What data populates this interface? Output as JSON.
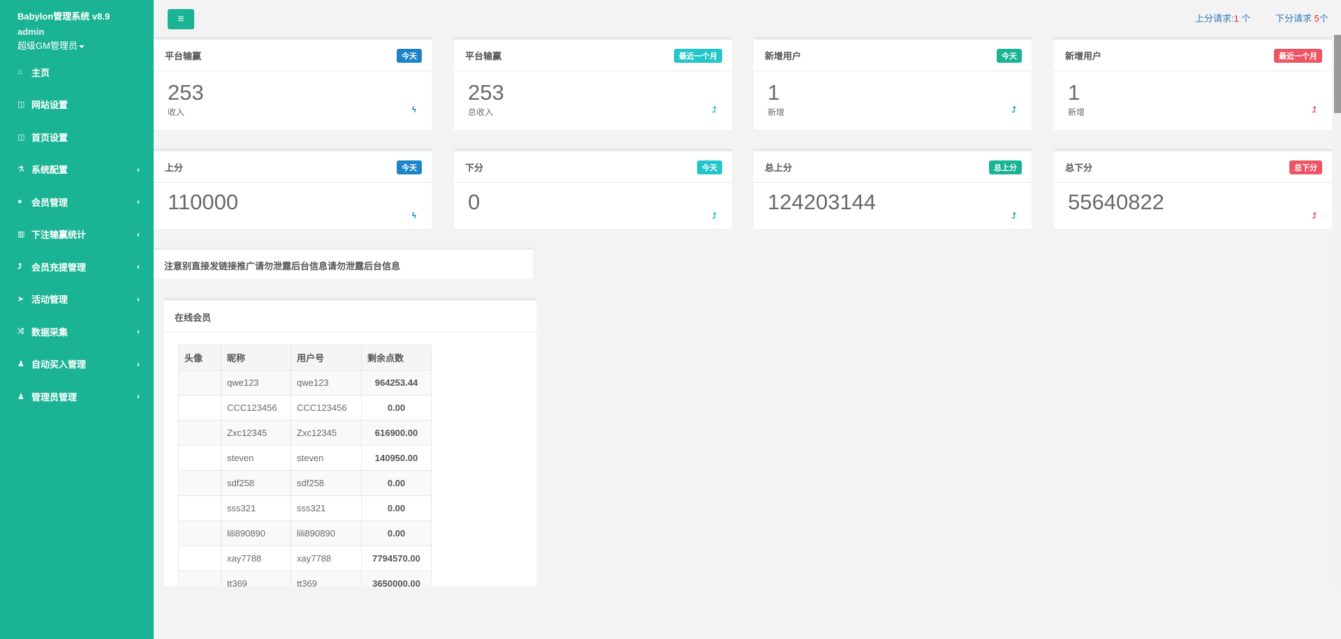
{
  "sidebar": {
    "brand": "Babylon管理系统 v8.9",
    "user": "admin",
    "role": "超级GM管理员",
    "items": [
      {
        "label": "主页",
        "icon": "home-icon",
        "glyph": "⌂",
        "sub": false
      },
      {
        "label": "网站设置",
        "icon": "columns-icon",
        "glyph": "◫",
        "sub": false
      },
      {
        "label": "首页设置",
        "icon": "columns-icon",
        "glyph": "◫",
        "sub": false
      },
      {
        "label": "系统配置",
        "icon": "flask-icon",
        "glyph": "⚗",
        "sub": true
      },
      {
        "label": "会员管理",
        "icon": "user-icon",
        "glyph": "●",
        "sub": true
      },
      {
        "label": "下注输赢统计",
        "icon": "bar-chart-icon",
        "glyph": "▥",
        "sub": true
      },
      {
        "label": "会员充提管理",
        "icon": "level-up-icon",
        "glyph": "⮥",
        "sub": true
      },
      {
        "label": "活动管理",
        "icon": "paper-plane-icon",
        "glyph": "➤",
        "sub": true
      },
      {
        "label": "数据采集",
        "icon": "random-icon",
        "glyph": "⤨",
        "sub": true
      },
      {
        "label": "自动买入管理",
        "icon": "male-icon",
        "glyph": "♟",
        "sub": true
      },
      {
        "label": "管理员管理",
        "icon": "male-icon",
        "glyph": "♟",
        "sub": true
      }
    ],
    "arrow": "‹"
  },
  "topbar": {
    "menu_glyph": "≡",
    "up_req_label": "上分请求:",
    "up_req_count": "1",
    "up_req_unit": " 个",
    "down_req_label": "下分请求 ",
    "down_req_count": "5",
    "down_req_unit": "个"
  },
  "cards": [
    {
      "title": "平台输赢",
      "badge": "今天",
      "badge_color": "#1c84c6",
      "value": "253",
      "sub": "收入",
      "icon_glyph": "ϟ",
      "icon_color": "#1c84c6"
    },
    {
      "title": "平台输赢",
      "badge": "最近一个月",
      "badge_color": "#23c6c8",
      "value": "253",
      "sub": "总收入",
      "icon_glyph": "⮥",
      "icon_color": "#23c6c8"
    },
    {
      "title": "新增用户",
      "badge": "今天",
      "badge_color": "#1ab394",
      "value": "1",
      "sub": "新增",
      "icon_glyph": "⮥",
      "icon_color": "#1ab394"
    },
    {
      "title": "新增用户",
      "badge": "最近一个月",
      "badge_color": "#ed5565",
      "value": "1",
      "sub": "新增",
      "icon_glyph": "⮥",
      "icon_color": "#ed5565"
    },
    {
      "title": "上分",
      "badge": "今天",
      "badge_color": "#1c84c6",
      "value": "110000",
      "sub": "",
      "icon_glyph": "ϟ",
      "icon_color": "#1c84c6"
    },
    {
      "title": "下分",
      "badge": "今天",
      "badge_color": "#23c6c8",
      "value": "0",
      "sub": "",
      "icon_glyph": "⮥",
      "icon_color": "#23c6c8"
    },
    {
      "title": "总上分",
      "badge": "总上分",
      "badge_color": "#1ab394",
      "value": "124203144",
      "sub": "",
      "icon_glyph": "⮥",
      "icon_color": "#1ab394"
    },
    {
      "title": "总下分",
      "badge": "总下分",
      "badge_color": "#ed5565",
      "value": "55640822",
      "sub": "",
      "icon_glyph": "⮥",
      "icon_color": "#ed5565"
    }
  ],
  "notice": "注意别直接发链接推广请勿泄露后台信息请勿泄露后台信息",
  "online": {
    "title": "在线会员",
    "columns": [
      "头像",
      "昵称",
      "用户号",
      "剩余点数"
    ],
    "rows": [
      [
        "",
        "qwe123",
        "qwe123",
        "964253.44"
      ],
      [
        "",
        "CCC123456",
        "CCC123456",
        "0.00"
      ],
      [
        "",
        "Zxc12345",
        "Zxc12345",
        "616900.00"
      ],
      [
        "",
        "steven",
        "steven",
        "140950.00"
      ],
      [
        "",
        "sdf258",
        "sdf258",
        "0.00"
      ],
      [
        "",
        "sss321",
        "sss321",
        "0.00"
      ],
      [
        "",
        "lili890890",
        "lili890890",
        "0.00"
      ],
      [
        "",
        "xay7788",
        "xay7788",
        "7794570.00"
      ],
      [
        "",
        "tt369",
        "tt369",
        "3650000.00"
      ]
    ]
  }
}
